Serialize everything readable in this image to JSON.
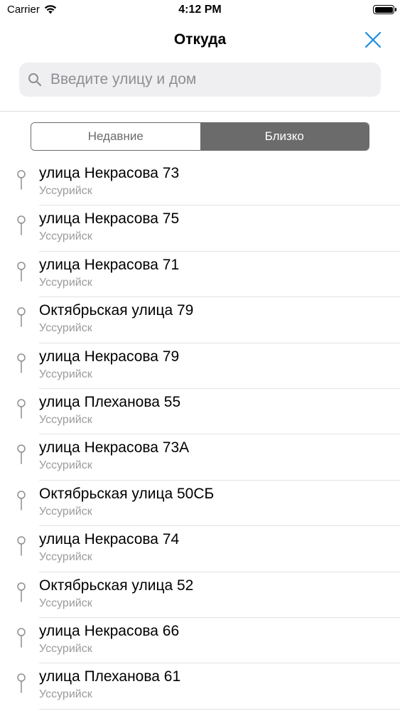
{
  "status_bar": {
    "carrier": "Carrier",
    "time": "4:12 PM",
    "battery_level": 1.0
  },
  "nav": {
    "title": "Откуда",
    "close_icon": "close-icon",
    "accent_color": "#1a8fe3"
  },
  "search": {
    "placeholder": "Введите улицу и дом",
    "value": "",
    "icon": "search-icon"
  },
  "segments": {
    "selected": 1,
    "items": [
      {
        "label": "Недавние"
      },
      {
        "label": "Близко"
      }
    ]
  },
  "list": {
    "icon": "location-pin-icon",
    "items": [
      {
        "title": "улица Некрасова 73",
        "subtitle": "Уссурийск"
      },
      {
        "title": "улица Некрасова 75",
        "subtitle": "Уссурийск"
      },
      {
        "title": "улица Некрасова 71",
        "subtitle": "Уссурийск"
      },
      {
        "title": "Октябрьская улица 79",
        "subtitle": "Уссурийск"
      },
      {
        "title": "улица Некрасова 79",
        "subtitle": "Уссурийск"
      },
      {
        "title": "улица Плеханова 55",
        "subtitle": "Уссурийск"
      },
      {
        "title": "улица Некрасова 73А",
        "subtitle": "Уссурийск"
      },
      {
        "title": "Октябрьская улица 50СБ",
        "subtitle": "Уссурийск"
      },
      {
        "title": "улица Некрасова 74",
        "subtitle": "Уссурийск"
      },
      {
        "title": "Октябрьская улица 52",
        "subtitle": "Уссурийск"
      },
      {
        "title": "улица Некрасова 66",
        "subtitle": "Уссурийск"
      },
      {
        "title": "улица Плеханова 61",
        "subtitle": "Уссурийск"
      }
    ]
  }
}
